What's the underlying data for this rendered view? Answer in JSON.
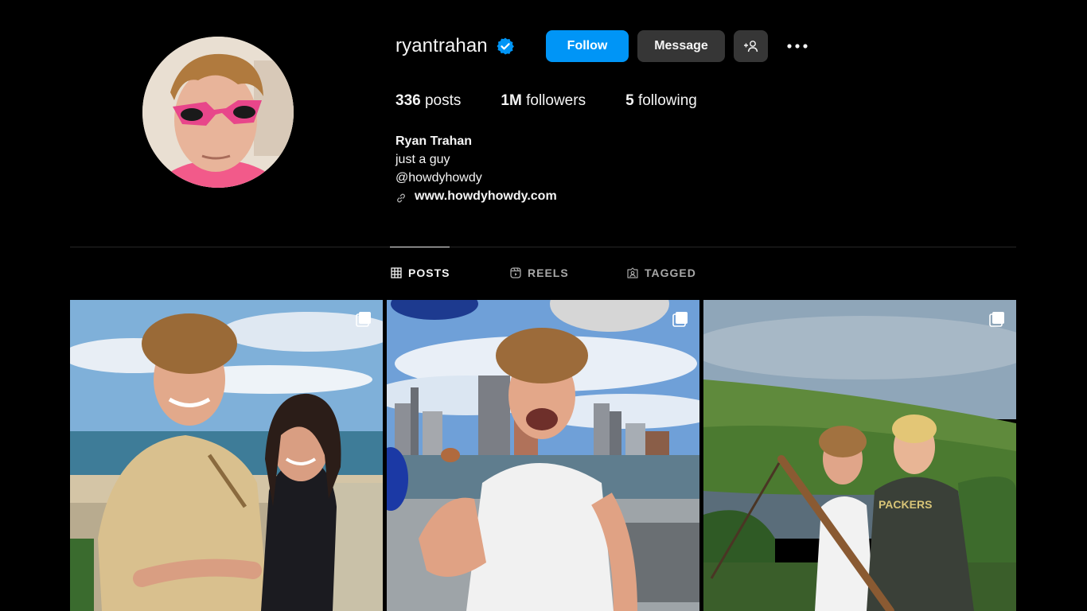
{
  "profile": {
    "username": "ryantrahan",
    "verified": true,
    "full_name": "Ryan Trahan",
    "bio_lines": [
      "just a guy",
      "@howdyhowdy"
    ],
    "link": "www.howdyhowdy.com"
  },
  "actions": {
    "follow_label": "Follow",
    "message_label": "Message",
    "suggest_label": "+👤",
    "more_label": "•••"
  },
  "stats": [
    {
      "value": "336",
      "label": "posts"
    },
    {
      "value": "1M",
      "label": "followers"
    },
    {
      "value": "5",
      "label": "following"
    }
  ],
  "tabs": [
    {
      "label": "POSTS",
      "icon": "grid-icon",
      "active": true
    },
    {
      "label": "REELS",
      "icon": "reels-icon",
      "active": false
    },
    {
      "label": "TAGGED",
      "icon": "tagged-icon",
      "active": false
    }
  ],
  "posts": [
    {
      "type": "carousel",
      "subject": "couple-by-lake"
    },
    {
      "type": "carousel",
      "subject": "penny-city-skyline"
    },
    {
      "type": "carousel",
      "subject": "hills-two-guys"
    }
  ],
  "colors": {
    "background": "#000000",
    "accent": "#0095f6",
    "secondary_button": "#363636",
    "muted_text": "#a8a8a8",
    "verified_blue": "#0095f6"
  }
}
